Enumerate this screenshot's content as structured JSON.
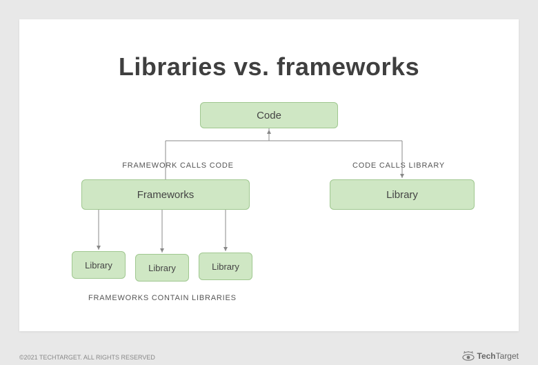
{
  "title": "Libraries vs. frameworks",
  "nodes": {
    "code": "Code",
    "frameworks": "Frameworks",
    "library_right": "Library",
    "lib1": "Library",
    "lib2": "Library",
    "lib3": "Library"
  },
  "annotations": {
    "framework_calls_code": "FRAMEWORK CALLS CODE",
    "code_calls_library": "CODE CALLS LIBRARY",
    "frameworks_contain_libraries": "FRAMEWORKS CONTAIN LIBRARIES"
  },
  "footer": {
    "copyright": "©2021 TECHTARGET. ALL RIGHTS RESERVED",
    "brand_left": "Tech",
    "brand_right": "Target"
  },
  "colors": {
    "box_fill": "#cfe7c4",
    "box_border": "#9fc78f",
    "title": "#3f3f3f",
    "canvas": "#ffffff",
    "page_bg": "#e8e8e8"
  }
}
